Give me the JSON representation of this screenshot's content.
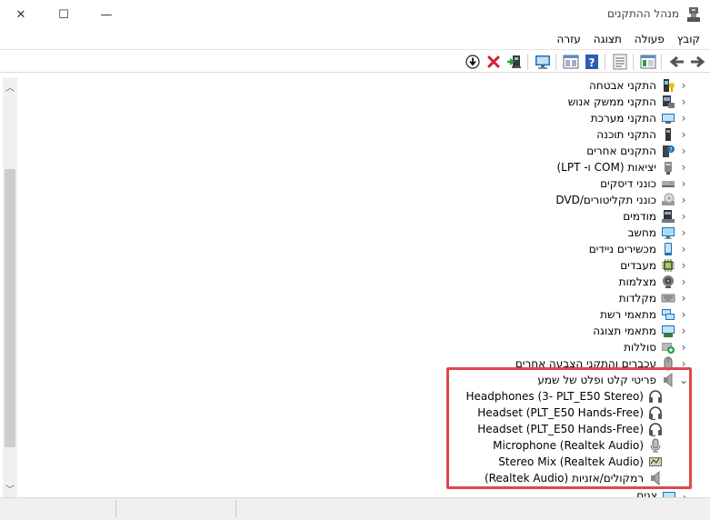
{
  "window": {
    "title": "מנהל ההתקנים",
    "controls": {
      "close": "✕",
      "maximize": "☐",
      "minimize": "—"
    }
  },
  "menu": [
    {
      "label": "קובץ"
    },
    {
      "label": "פעולה"
    },
    {
      "label": "תצוגה"
    },
    {
      "label": "עזרה"
    }
  ],
  "tree": {
    "categories": [
      {
        "label": "התקני אבטחה",
        "icon": "security-device-icon"
      },
      {
        "label": "התקני ממשק אנוש",
        "icon": "hid-icon"
      },
      {
        "label": "התקני מערכת",
        "icon": "system-device-icon"
      },
      {
        "label": "התקני תוכנה",
        "icon": "software-device-icon"
      },
      {
        "label": "התקנים אחרים",
        "icon": "unknown-device-icon"
      },
      {
        "label": "יציאות (COM ו- LPT)",
        "icon": "port-icon"
      },
      {
        "label": "כונני דיסקים",
        "icon": "disk-drive-icon"
      },
      {
        "label": "כונני תקליטורים/DVD",
        "icon": "dvd-drive-icon"
      },
      {
        "label": "מודמים",
        "icon": "modem-icon"
      },
      {
        "label": "מחשב",
        "icon": "computer-icon"
      },
      {
        "label": "מכשירים ניידים",
        "icon": "portable-device-icon"
      },
      {
        "label": "מעבדים",
        "icon": "processor-icon"
      },
      {
        "label": "מצלמות",
        "icon": "camera-icon"
      },
      {
        "label": "מקלדות",
        "icon": "keyboard-icon"
      },
      {
        "label": "מתאמי רשת",
        "icon": "network-adapter-icon"
      },
      {
        "label": "מתאמי תצוגה",
        "icon": "display-adapter-icon"
      },
      {
        "label": "סוללות",
        "icon": "battery-icon"
      },
      {
        "label": "עכברים והתקני הצבעה אחרים",
        "icon": "mouse-icon"
      }
    ],
    "audio": {
      "label": "פריטי קלט ופלט של שמע",
      "icon": "speaker-icon",
      "children": [
        {
          "label": "Headphones (3- PLT_E50 Stereo)",
          "icon": "headphones-icon"
        },
        {
          "label": "Headset (PLT_E50 Hands-Free)",
          "icon": "headset-icon"
        },
        {
          "label": "Headset (PLT_E50 Hands-Free)",
          "icon": "headset-icon"
        },
        {
          "label": "Microphone (Realtek Audio)",
          "icon": "microphone-icon"
        },
        {
          "label": "Stereo Mix (Realtek Audio)",
          "icon": "stereo-mix-icon"
        },
        {
          "label": "רמקולים/אזניות (Realtek Audio)",
          "icon": "speaker-icon"
        }
      ]
    },
    "partial_last": {
      "label": "צגים",
      "icon": "monitor-icon"
    }
  },
  "colors": {
    "highlight": "#e0474c",
    "toolbar_blue": "#2a7fd4",
    "delete_red": "#d42027",
    "install_green": "#2a9d3c"
  }
}
